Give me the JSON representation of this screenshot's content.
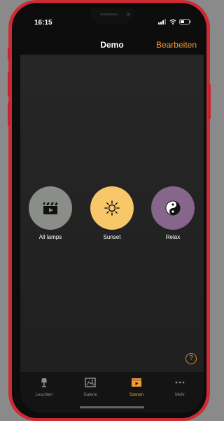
{
  "status_bar": {
    "time": "16:15"
  },
  "nav": {
    "title": "Demo",
    "action_label": "Bearbeiten"
  },
  "scenes": [
    {
      "label": "All lamps",
      "color": "#8a8d88",
      "icon": "clapperboard-icon"
    },
    {
      "label": "Sunset",
      "color": "#f7c76a",
      "icon": "sun-icon"
    },
    {
      "label": "Relax",
      "color": "#86668a",
      "icon": "yin-yang-icon"
    }
  ],
  "help_label": "?",
  "tabs": [
    {
      "label": "Leuchten",
      "icon": "lamp-icon",
      "active": false
    },
    {
      "label": "Galerie",
      "icon": "gallery-icon",
      "active": false
    },
    {
      "label": "Szenen",
      "icon": "scenes-icon",
      "active": true
    },
    {
      "label": "Mehr",
      "icon": "more-icon",
      "active": false
    }
  ],
  "colors": {
    "accent": "#f29b37",
    "frame": "#d02a33"
  }
}
